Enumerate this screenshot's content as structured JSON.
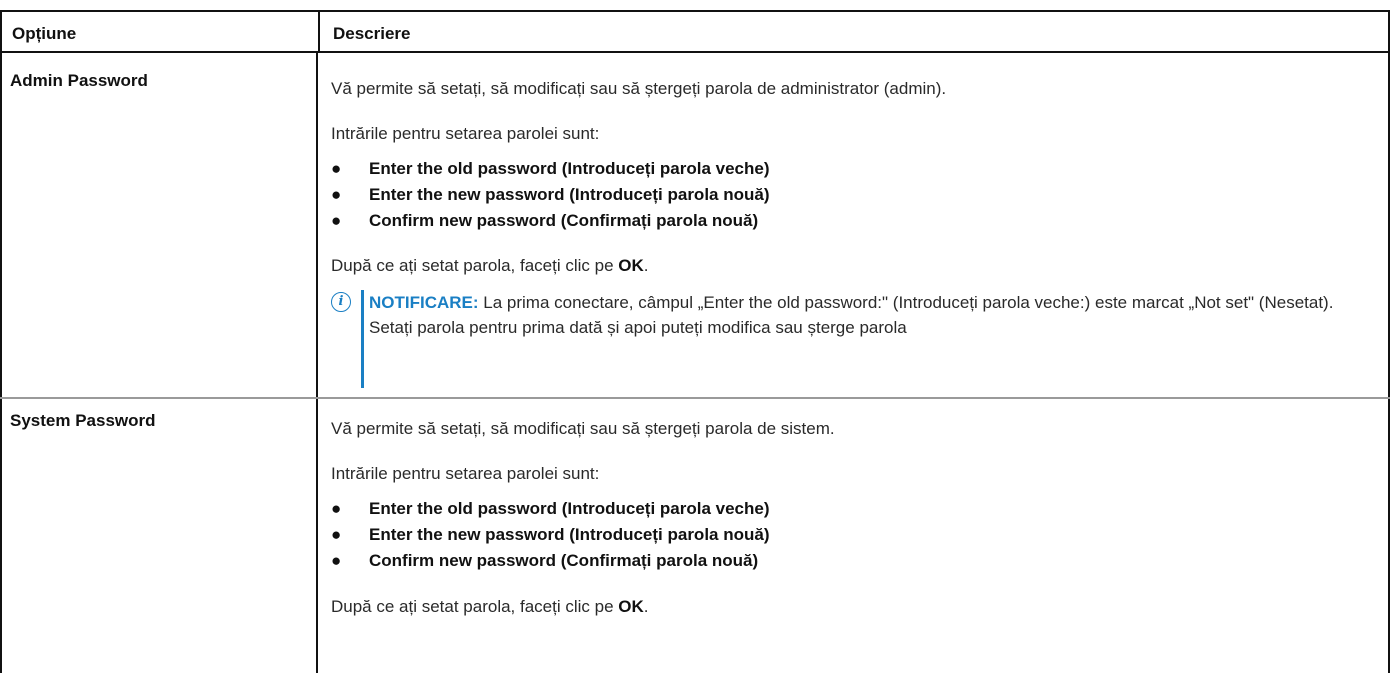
{
  "header": {
    "col1": "Opțiune",
    "col2": "Descriere"
  },
  "rows": [
    {
      "option": "Admin Password",
      "desc": "Vă permite să setați, să modificați sau să ștergeți parola de administrator (admin).",
      "intro": "Intrările pentru setarea parolei sunt:",
      "bullets": [
        "Enter the old password (Introduceți parola veche)",
        "Enter the new password (Introduceți parola nouă)",
        "Confirm new password (Confirmați parola nouă)"
      ],
      "after_prefix": "După ce ați setat parola, faceți clic pe ",
      "after_bold": "OK",
      "after_suffix": ".",
      "note_label": "NOTIFICARE:",
      "note_text": " La prima conectare, câmpul „Enter the old password:\" (Introduceți parola veche:) este marcat „Not set\" (Nesetat). Setați parola pentru prima dată și apoi puteți modifica sau șterge parola",
      "note_icon": "info-icon"
    },
    {
      "option": "System Password",
      "desc": "Vă permite să setați, să modificați sau să ștergeți parola de sistem.",
      "intro": "Intrările pentru setarea parolei sunt:",
      "bullets": [
        "Enter the old password (Introduceți parola veche)",
        "Enter the new password (Introduceți parola nouă)",
        "Confirm new password (Confirmați parola nouă)"
      ],
      "after_prefix": "După ce ați setat parola, faceți clic pe ",
      "after_bold": "OK",
      "after_suffix": "."
    }
  ],
  "bullet_glyph": "●",
  "note_icon_glyph": "i",
  "colors": {
    "accent": "#1a7fc4",
    "text": "#2a2a2a",
    "border": "#111111",
    "row_divider": "#9a9a9a"
  }
}
